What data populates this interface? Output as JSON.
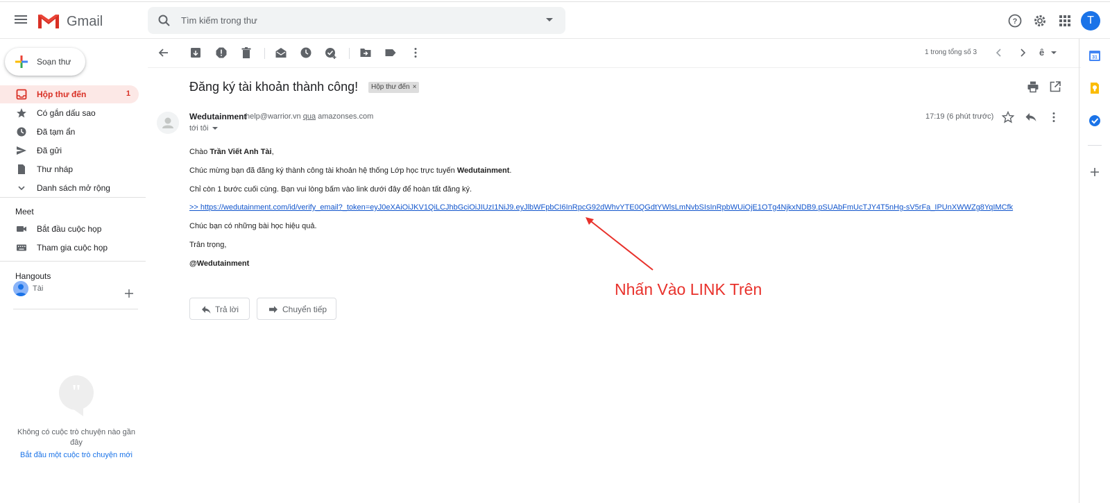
{
  "header": {
    "app_name": "Gmail",
    "search_placeholder": "Tìm kiếm trong thư",
    "avatar_letter": "T"
  },
  "sidebar": {
    "compose_label": "Soạn thư",
    "items": [
      {
        "label": "Hộp thư đến",
        "count": "1",
        "icon": "inbox-icon"
      },
      {
        "label": "Có gắn dấu sao",
        "icon": "star-icon"
      },
      {
        "label": "Đã tạm ẩn",
        "icon": "clock-icon"
      },
      {
        "label": "Đã gửi",
        "icon": "send-icon"
      },
      {
        "label": "Thư nháp",
        "icon": "draft-icon"
      },
      {
        "label": "Danh sách mở rộng",
        "icon": "chevron-down-icon"
      }
    ],
    "meet": {
      "title": "Meet",
      "items": [
        {
          "label": "Bắt đầu cuộc họp",
          "icon": "videocam-icon"
        },
        {
          "label": "Tham gia cuộc họp",
          "icon": "keyboard-icon"
        }
      ]
    },
    "hangouts": {
      "title": "Hangouts",
      "user_name": "Tài",
      "empty_text": "Không có cuộc trò chuyện nào gần đây",
      "start_link": "Bắt đầu một cuộc trò chuyện mới"
    }
  },
  "toolbar": {
    "pager_text": "1 trong tổng số 3",
    "input_tool": "ê"
  },
  "email": {
    "subject": "Đăng ký tài khoản thành công!",
    "label_chip": "Hộp thư đến",
    "label_close": "×",
    "sender_name": "Wedutainment",
    "sender_email_pre": "help@warrior.vn",
    "sender_via": "qua",
    "sender_domain": "amazonses.com",
    "to_me": "tới tôi",
    "timestamp": "17:19 (6 phút trước)",
    "greeting_pre": "Chào",
    "greeting_name": "Trần Viết Anh Tài",
    "greeting_post": ",",
    "line1_pre": "Chúc mừng bạn đã đăng ký thành công tài khoản hệ thống Lớp học trực tuyến",
    "line1_brand": "Wedutainment",
    "line1_post": ".",
    "line2": "Chỉ còn 1 bước cuối cùng. Bạn vui lòng bấm vào link dưới đây để hoàn tất đăng ký.",
    "verify_link": ">> https://wedutainment.com/id/verify_email?_token=eyJ0eXAiOiJKV1QiLCJhbGciOiJIUzI1NiJ9.eyJlbWFpbCI6InRpcG92dWhvYTE0QGdtYWlsLmNvbSIsInRpbWUiOjE1OTg4NjkxNDB9.pSUAbFmUcTJY4T5nHg-sV5rFa_IPUnXWWZg8YqIMCfk",
    "line3": "Chúc bạn có những bài học hiệu quả.",
    "line4": "Trân trọng,",
    "signature": "@Wedutainment"
  },
  "actions": {
    "reply_label": "Trả lời",
    "forward_label": "Chuyển tiếp"
  },
  "annotation": {
    "text": "Nhấn Vào LINK Trên",
    "color": "#e8312b"
  },
  "colors": {
    "accent_red": "#d93025",
    "link_blue": "#1155cc",
    "active_bg": "#fce8e6"
  }
}
